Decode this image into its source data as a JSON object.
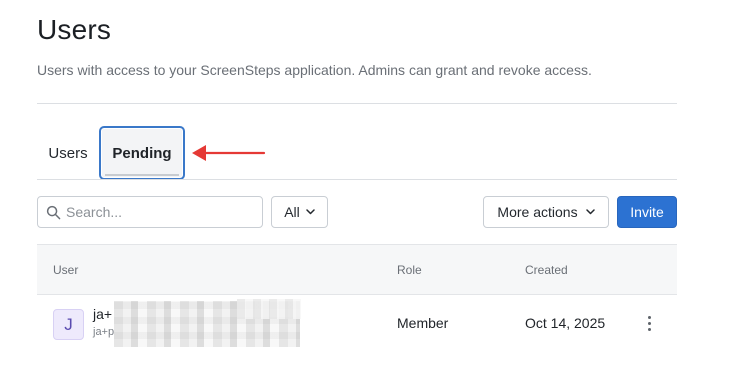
{
  "header": {
    "title": "Users",
    "subtitle": "Users with access to your ScreenSteps application. Admins can grant and revoke access."
  },
  "tabs": [
    {
      "label": "Users",
      "active": false
    },
    {
      "label": "Pending",
      "active": true
    }
  ],
  "annotation": {
    "arrow_color": "#e53935"
  },
  "toolbar": {
    "search_placeholder": "Search...",
    "search_value": "",
    "filter_selected": "All",
    "more_actions_label": "More actions",
    "invite_label": "Invite"
  },
  "table": {
    "columns": [
      "User",
      "Role",
      "Created"
    ],
    "rows": [
      {
        "avatar_initial": "J",
        "name": "ja+",
        "email": "ja+p",
        "role": "Member",
        "created": "Oct 14, 2025"
      }
    ]
  },
  "colors": {
    "primary": "#2c72d2",
    "active_tab_border": "#3a78c9",
    "avatar_bg": "#eeeafc"
  }
}
